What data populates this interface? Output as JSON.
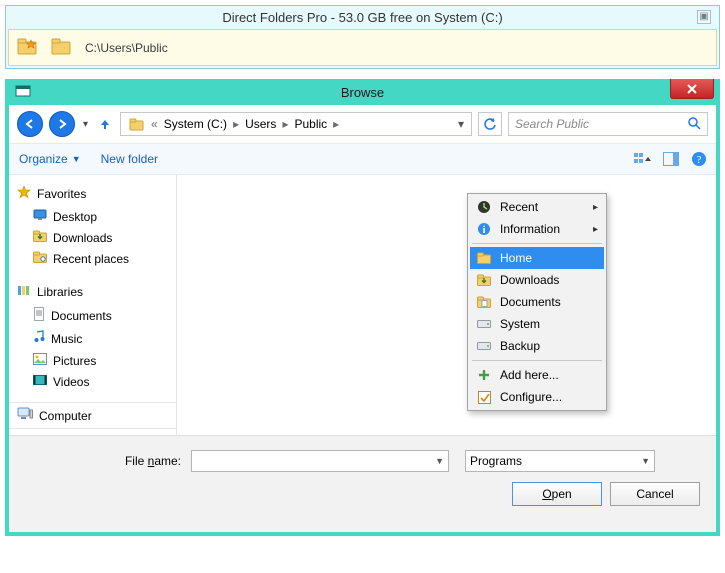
{
  "banner": {
    "title": "Direct Folders Pro  -  53.0 GB free on System (C:)",
    "close_glyph": "▣",
    "path": "C:\\Users\\Public"
  },
  "window": {
    "title": "Browse"
  },
  "breadcrumb": {
    "root_sep": "«",
    "items": [
      "System (C:)",
      "Users",
      "Public"
    ]
  },
  "search": {
    "placeholder": "Search Public"
  },
  "toolbar": {
    "organize": "Organize",
    "newfolder": "New folder"
  },
  "tree": {
    "favorites": {
      "label": "Favorites",
      "items": [
        "Desktop",
        "Downloads",
        "Recent places"
      ]
    },
    "libraries": {
      "label": "Libraries",
      "items": [
        "Documents",
        "Music",
        "Pictures",
        "Videos"
      ]
    },
    "computer": "Computer"
  },
  "menu": {
    "recent": "Recent",
    "information": "Information",
    "home": "Home",
    "downloads": "Downloads",
    "documents": "Documents",
    "system": "System",
    "backup": "Backup",
    "add": "Add here...",
    "configure": "Configure..."
  },
  "bottom": {
    "filename_label_pre": "File ",
    "filename_label_u": "n",
    "filename_label_post": "ame:",
    "filter": "Programs",
    "open_u": "O",
    "open_rest": "pen",
    "cancel": "Cancel"
  }
}
